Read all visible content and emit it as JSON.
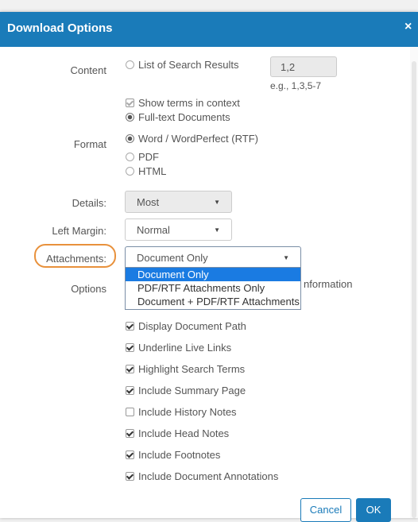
{
  "dialog": {
    "title": "Download Options",
    "close_label": "×"
  },
  "content": {
    "label": "Content",
    "list_option": "List of Search Results",
    "range_value": "1,2",
    "range_hint": "e.g., 1,3,5-7",
    "show_terms": "Show terms in context",
    "fulltext_option": "Full-text Documents"
  },
  "format": {
    "label": "Format",
    "options": [
      "Word / WordPerfect (RTF)",
      "PDF",
      "HTML"
    ]
  },
  "details": {
    "label": "Details:",
    "value": "Most"
  },
  "left_margin": {
    "label": "Left Margin:",
    "value": "Normal"
  },
  "attachments": {
    "label": "Attachments:",
    "value": "Document Only",
    "dropdown_options": [
      "Document Only",
      "PDF/RTF Attachments Only",
      "Document + PDF/RTF Attachments"
    ]
  },
  "options": {
    "label": "Options",
    "partial_text": "nformation",
    "checkboxes": [
      {
        "label": "Display Document Path",
        "checked": true
      },
      {
        "label": "Underline Live Links",
        "checked": true
      },
      {
        "label": "Highlight Search Terms",
        "checked": true
      },
      {
        "label": "Include Summary Page",
        "checked": true
      },
      {
        "label": "Include History Notes",
        "checked": false
      },
      {
        "label": "Include Head Notes",
        "checked": true
      },
      {
        "label": "Include Footnotes",
        "checked": true
      },
      {
        "label": "Include Document Annotations",
        "checked": true
      }
    ]
  },
  "buttons": {
    "cancel": "Cancel",
    "ok": "OK"
  },
  "colors": {
    "accent": "#1a7bb9",
    "highlight_ring": "#e8913c",
    "selected_item": "#1a7be2"
  }
}
